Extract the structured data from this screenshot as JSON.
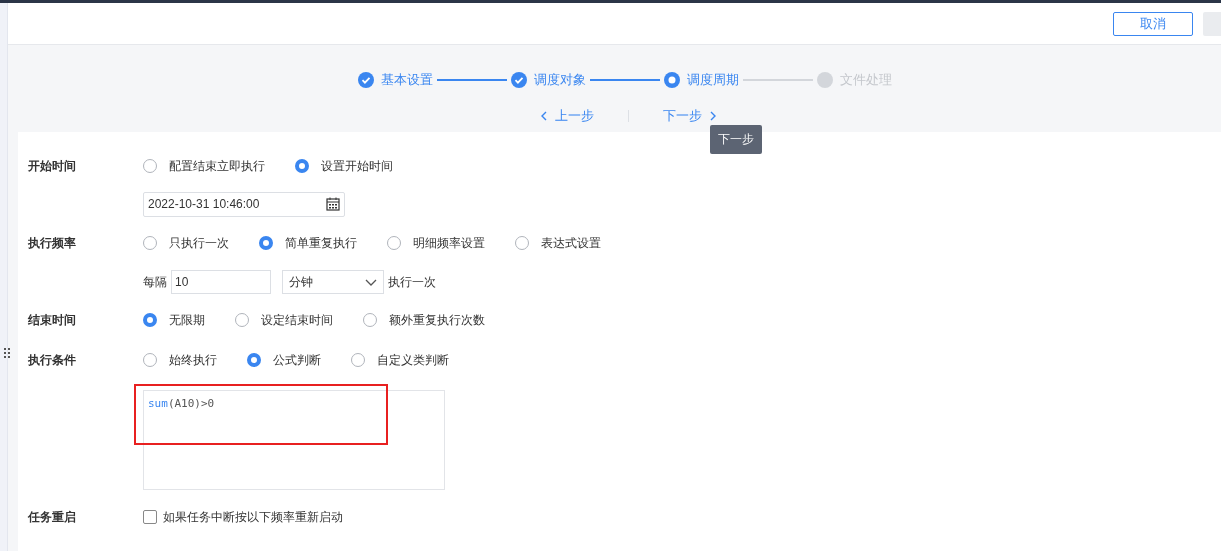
{
  "header": {
    "cancel_button": "取消"
  },
  "steps": [
    {
      "label": "基本设置",
      "completed": true,
      "selected": false
    },
    {
      "label": "调度对象",
      "completed": true,
      "selected": false
    },
    {
      "label": "调度周期",
      "completed": false,
      "selected": true
    },
    {
      "label": "文件处理",
      "completed": false,
      "selected": false
    }
  ],
  "nav": {
    "prev": "上一步",
    "next": "下一步",
    "tooltip": "下一步"
  },
  "form": [
    {
      "kind": "radio",
      "label": "开始时间",
      "options": [
        {
          "label": "配置结束立即执行",
          "selected": false
        },
        {
          "label": "设置开始时间",
          "selected": true
        }
      ]
    },
    {
      "kind": "datetime",
      "value": "2022-10-31 10:46:00"
    },
    {
      "kind": "radio",
      "label": "执行频率",
      "options": [
        {
          "label": "只执行一次",
          "selected": false
        },
        {
          "label": "简单重复执行",
          "selected": true
        },
        {
          "label": "明细频率设置",
          "selected": false
        },
        {
          "label": "表达式设置",
          "selected": false
        }
      ]
    },
    {
      "kind": "interval",
      "prefix": "每隔",
      "value": "10",
      "unit": "分钟",
      "suffix": "执行一次"
    },
    {
      "kind": "radio",
      "label": "结束时间",
      "options": [
        {
          "label": "无限期",
          "selected": true
        },
        {
          "label": "设定结束时间",
          "selected": false
        },
        {
          "label": "额外重复执行次数",
          "selected": false
        }
      ]
    },
    {
      "kind": "radio",
      "label": "执行条件",
      "options": [
        {
          "label": "始终执行",
          "selected": false
        },
        {
          "label": "公式判断",
          "selected": true
        },
        {
          "label": "自定义类判断",
          "selected": false
        }
      ]
    },
    {
      "kind": "formula",
      "tokens": [
        {
          "text": "sum",
          "kind": "function"
        },
        {
          "text": "(A10)>0",
          "kind": "plain"
        }
      ],
      "highlighted": true
    },
    {
      "kind": "checkbox",
      "label": "任务重启",
      "option": {
        "label": "如果任务中断按以下频率重新启动",
        "checked": false
      }
    }
  ]
}
